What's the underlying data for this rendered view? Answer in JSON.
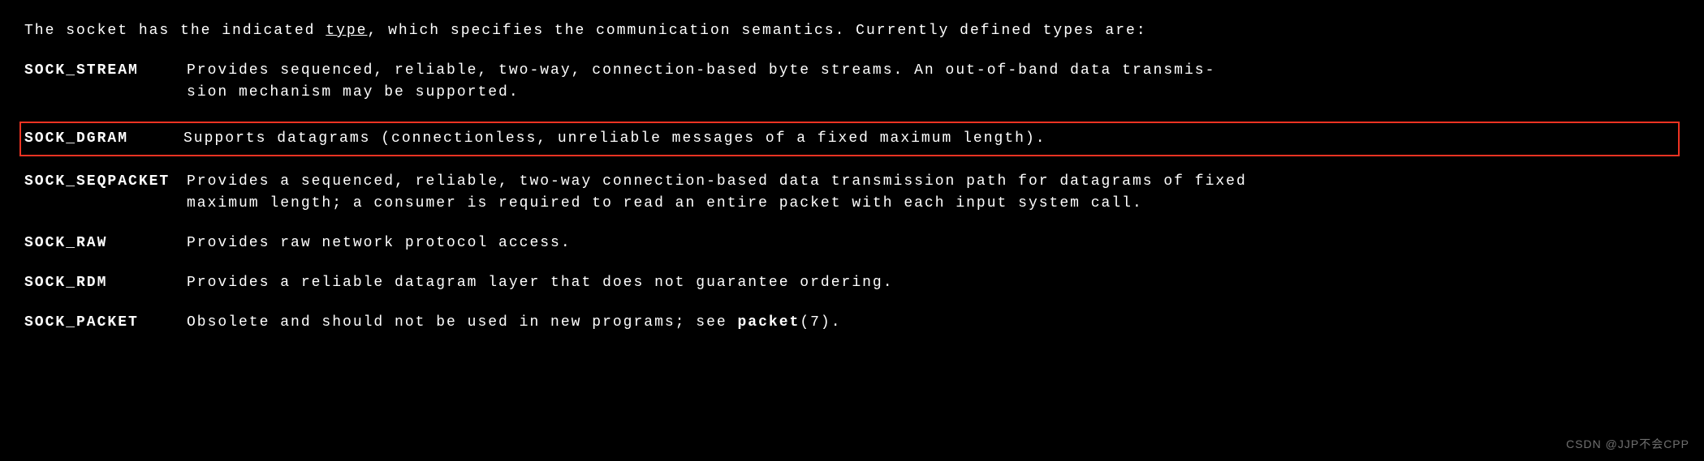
{
  "intro": {
    "part1": "The socket has the indicated ",
    "underlined": "type",
    "part2": ", which specifies the communication semantics.  Currently defined types are:"
  },
  "definitions": {
    "stream": {
      "term": "SOCK_STREAM",
      "desc": "Provides sequenced, reliable, two-way, connection-based byte streams.  An out-of-band  data  transmis-",
      "desc2": "sion mechanism may be supported."
    },
    "dgram": {
      "term": "SOCK_DGRAM",
      "desc": "Supports datagrams (connectionless, unreliable messages of a fixed maximum length)."
    },
    "seqpacket": {
      "term": "SOCK_SEQPACKET",
      "desc": "Provides a sequenced, reliable, two-way connection-based data transmission path for datagrams of fixed",
      "desc2": "maximum length; a consumer is required to read an entire packet with each input system call."
    },
    "raw": {
      "term": "SOCK_RAW",
      "desc": "Provides raw network protocol access."
    },
    "rdm": {
      "term": "SOCK_RDM",
      "desc": "Provides a reliable datagram layer that does not guarantee ordering."
    },
    "packet": {
      "term": "SOCK_PACKET",
      "desc_part1": "Obsolete and should not be used in new programs; see ",
      "desc_bold": "packet",
      "desc_part2": "(7)."
    }
  },
  "watermark": "CSDN @JJP不会CPP"
}
